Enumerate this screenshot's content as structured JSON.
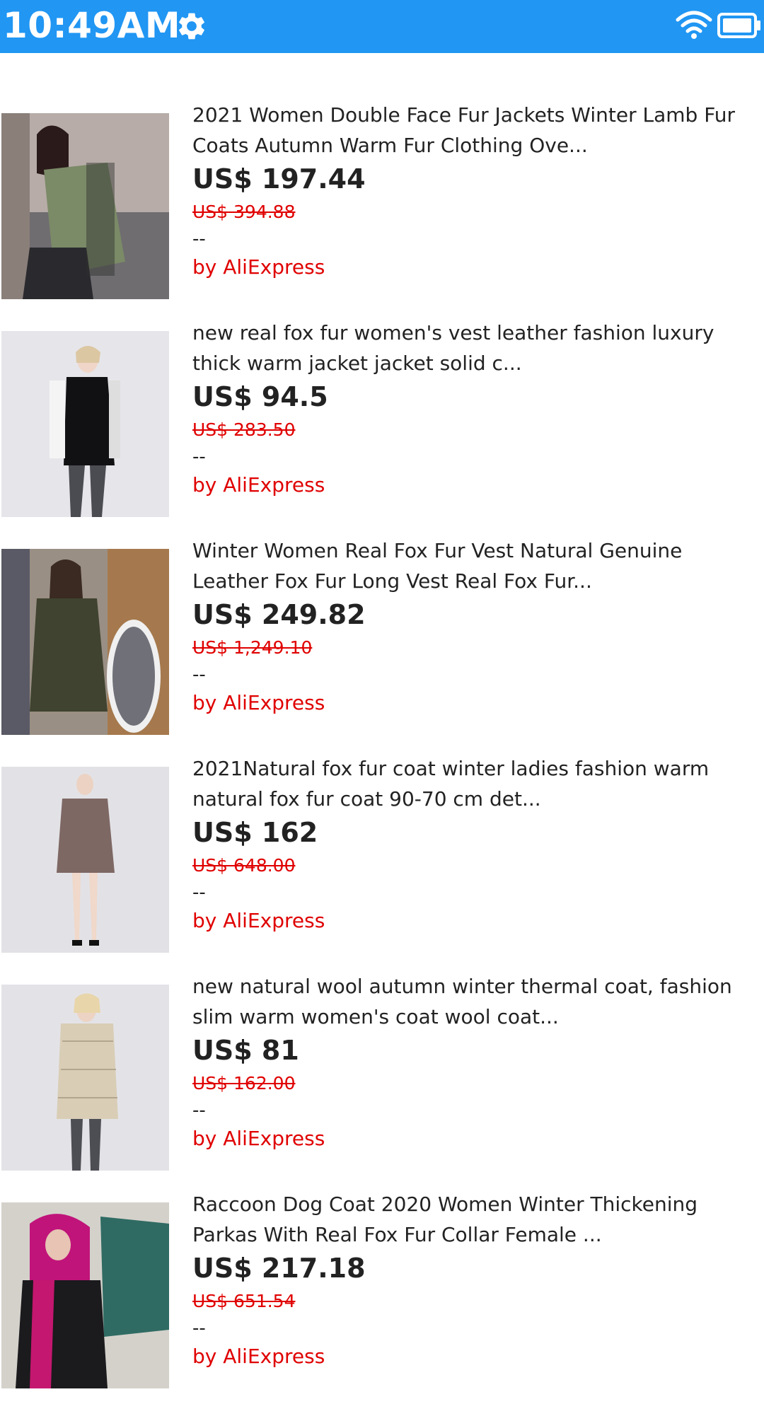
{
  "status_bar": {
    "time": "10:49AM",
    "icons": [
      "gear-icon",
      "wifi-icon",
      "battery-icon"
    ],
    "color": "#2196F3"
  },
  "products": [
    {
      "title": "2021 Women Double Face Fur Jackets Winter Lamb Fur Coats Autumn Warm Fur Clothing Ove...",
      "price": "US$ 197.44",
      "original_price": "US$ 394.88",
      "rating": "--",
      "seller": "by AliExpress"
    },
    {
      "title": "new real fox fur women's vest leather fashion luxury thick warm jacket jacket solid c...",
      "price": "US$ 94.5",
      "original_price": "US$ 283.50",
      "rating": "--",
      "seller": "by AliExpress"
    },
    {
      "title": "Winter Women Real Fox Fur Vest Natural Genuine Leather Fox Fur Long Vest Real Fox Fur...",
      "price": "US$ 249.82",
      "original_price": "US$ 1,249.10",
      "rating": "--",
      "seller": "by AliExpress"
    },
    {
      "title": "2021Natural fox fur coat winter ladies fashion warm natural fox fur coat 90-70 cm det...",
      "price": "US$ 162",
      "original_price": "US$ 648.00",
      "rating": "--",
      "seller": "by AliExpress"
    },
    {
      "title": "new natural wool autumn winter thermal coat, fashion slim warm women's coat wool coat...",
      "price": "US$ 81",
      "original_price": "US$ 162.00",
      "rating": "--",
      "seller": "by AliExpress"
    },
    {
      "title": "Raccoon Dog Coat 2020 Women Winter Thickening Parkas With Real Fox Fur Collar Female ...",
      "price": "US$ 217.18",
      "original_price": "US$ 651.54",
      "rating": "--",
      "seller": "by AliExpress"
    }
  ],
  "colors": {
    "price_strike": "#e00000",
    "seller": "#e00000",
    "text": "#222222"
  }
}
